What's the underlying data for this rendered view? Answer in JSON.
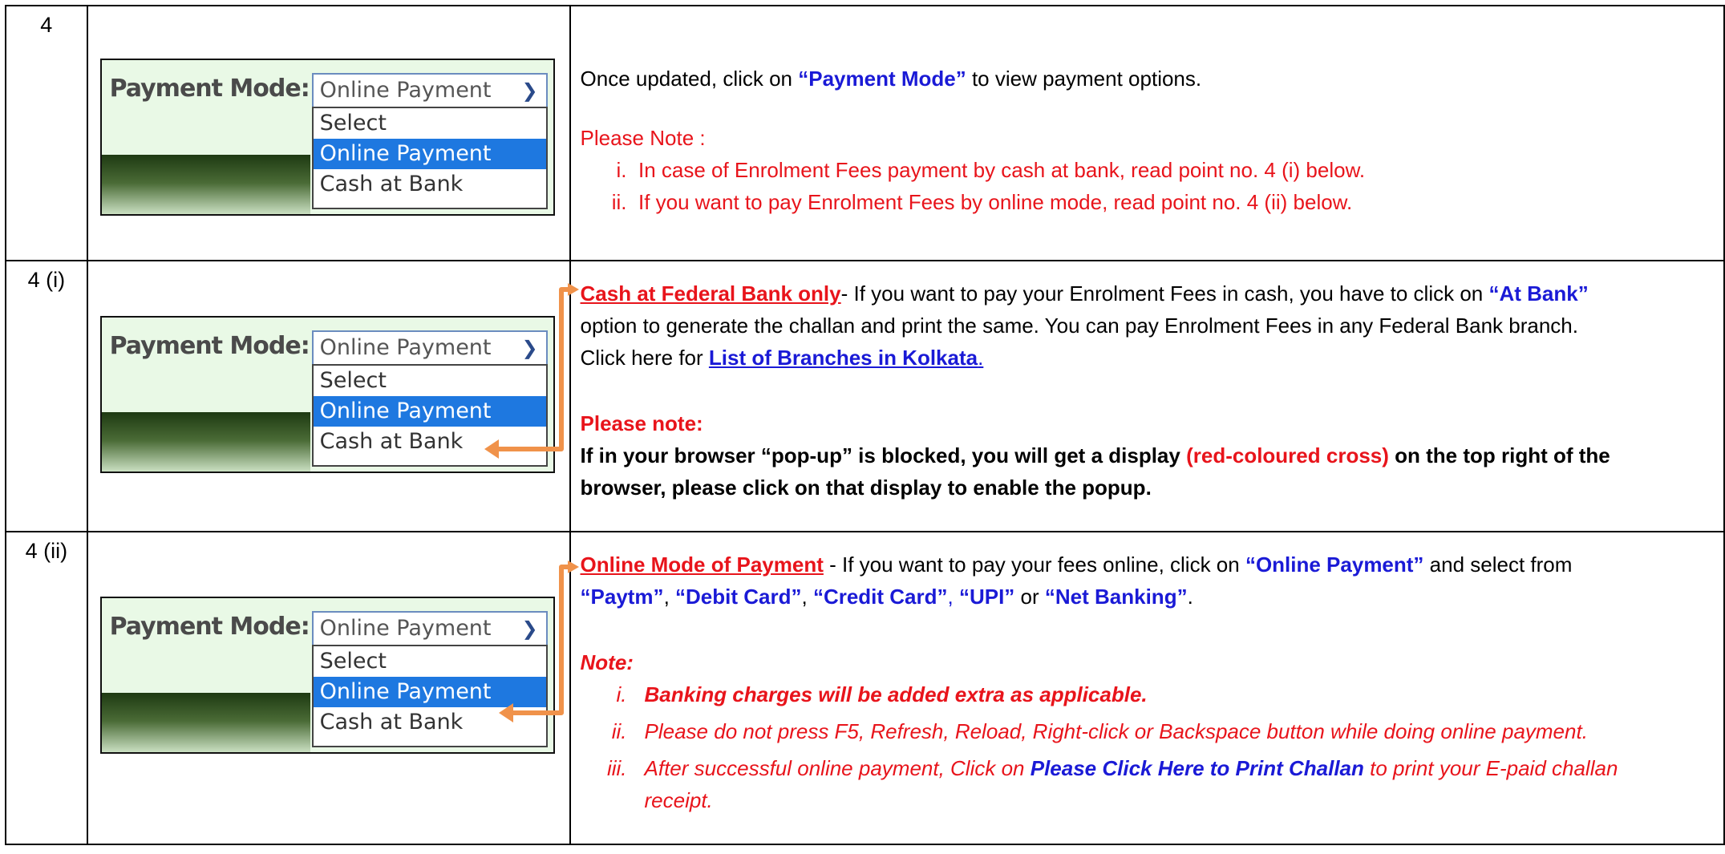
{
  "widget": {
    "label": "Payment Mode",
    "colon": ":",
    "selected": "Online Payment",
    "options": [
      "Select",
      "Online Payment",
      "Cash at Bank"
    ]
  },
  "rows": [
    {
      "num": "4",
      "intro_pre": "Once updated, click on ",
      "intro_hl": "“Payment Mode”",
      "intro_post": " to view payment options.",
      "note_heading": "Please Note :",
      "notes": [
        {
          "mark": "i.",
          "text": "In case of Enrolment Fees payment by cash at bank, read point no. 4 (i) below."
        },
        {
          "mark": "ii.",
          "text": "If you want to pay Enrolment Fees by online mode, read point no. 4 (ii) below."
        }
      ]
    },
    {
      "num": "4 (i)",
      "title": "Cash at Federal Bank only",
      "p1": "- If you want to pay your Enrolment Fees in cash, you have to click on ",
      "p1_hl": "“At Bank”",
      "p2": "option to generate the challan and print the same. You can pay Enrolment Fees in any Federal Bank branch.",
      "p3_pre": "Click here for ",
      "p3_link": "List of Branches in Kolkata",
      "p3_post": ".",
      "note_heading": "Please note:",
      "note1": "If in your browser “pop-up” is blocked, you will get a display ",
      "note_red": "(red-coloured cross)",
      "note2": " on the top right of the",
      "note3": "browser, please click on that display to enable the popup."
    },
    {
      "num": "4 (ii)",
      "title": "Online Mode of Payment",
      "p1": " - If you want to pay your fees online, click on ",
      "p1_hl": "“Online Payment”",
      "p1_post": " and select from",
      "opt1": "“Paytm”",
      "sep1": ", ",
      "opt2": "“Debit Card”",
      "sep2": ", ",
      "opt3": "“Credit Card”",
      "sep3": ", ",
      "opt4": "“UPI”",
      "sep4": " or ",
      "opt5": "“Net Banking”",
      "sep5": ".",
      "note_heading": "Note:",
      "notes": [
        {
          "mark": "i.",
          "text": "Banking charges will be added extra as applicable."
        },
        {
          "mark": "ii.",
          "text": "Please do not press F5, Refresh, Reload, Right-click or Backspace button while doing online payment."
        },
        {
          "mark": "iii.",
          "text_pre": "After successful online payment, Click on ",
          "text_hl": "Please Click Here to Print Challan",
          "text_post": " to print your E-paid challan",
          "text_cont": "receipt."
        }
      ]
    }
  ],
  "colors": {
    "accent_blue": "#1a1ad6",
    "note_red": "#e8141b",
    "arrow_orange": "#f0924a",
    "highlight": "#1e78e0"
  }
}
